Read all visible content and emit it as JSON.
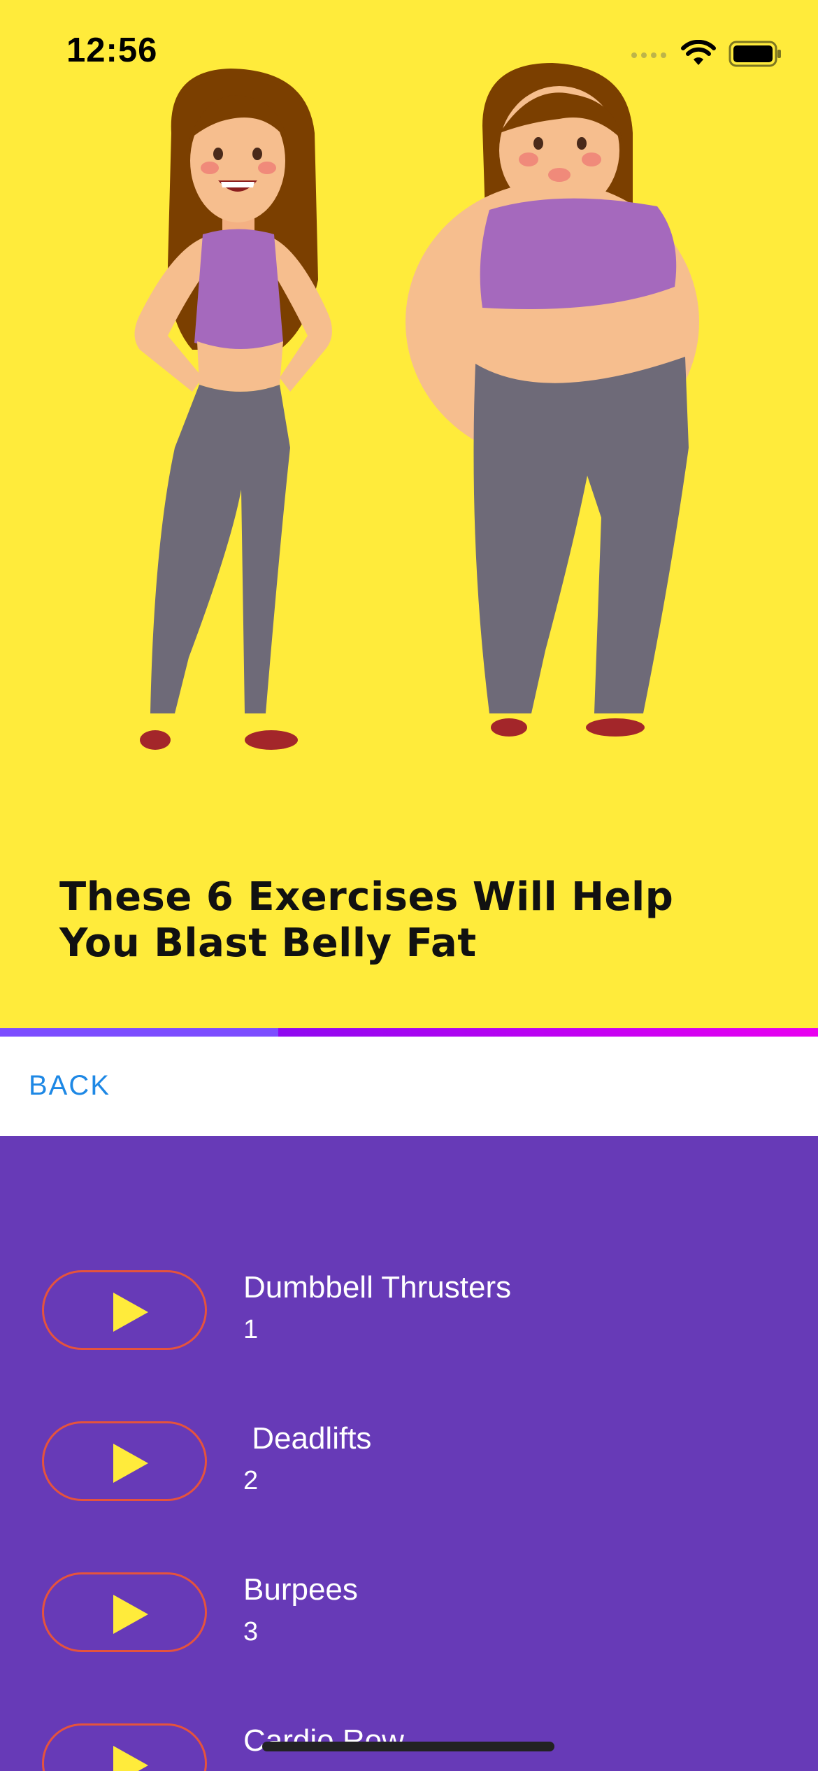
{
  "status_bar": {
    "time": "12:56"
  },
  "header": {
    "title": "These 6 Exercises Will Help You Blast Belly Fat"
  },
  "progress": {
    "value": 0.34
  },
  "nav": {
    "back_label": "BACK"
  },
  "exercises": [
    {
      "name": "Dumbbell Thrusters",
      "number": "1"
    },
    {
      "name": " Deadlifts",
      "number": "2"
    },
    {
      "name": "Burpees",
      "number": "3"
    },
    {
      "name": "Cardio Row",
      "number": ""
    }
  ],
  "colors": {
    "hero_bg": "#FFEB3B",
    "list_bg": "#673AB7",
    "back_text": "#1E88E5",
    "play_icon": "#FFEB3B",
    "play_border": "#E5533D"
  },
  "icons": [
    "signal-icon",
    "wifi-icon",
    "battery-icon",
    "play-icon"
  ]
}
